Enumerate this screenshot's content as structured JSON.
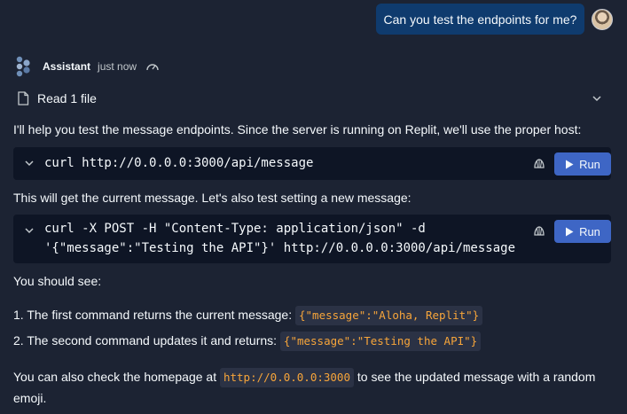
{
  "user_message": {
    "text": "Can you test the endpoints for me?"
  },
  "assistant": {
    "name": "Assistant",
    "time": "just now"
  },
  "read_file": {
    "label": "Read 1 file"
  },
  "intro": "I'll help you test the message endpoints. Since the server is running on Replit, we'll use the proper host:",
  "code_blocks": [
    {
      "lines": [
        "curl http://0.0.0.0:3000/api/message"
      ],
      "run_label": "Run"
    },
    {
      "lines": [
        "curl -X POST -H \"Content-Type: application/json\" -d",
        "'{\"message\":\"Testing the API\"}' http://0.0.0.0:3000/api/message"
      ],
      "run_label": "Run"
    }
  ],
  "mid_text": "This will get the current message. Let's also test setting a new message:",
  "should_see": "You should see:",
  "list": [
    {
      "prefix": "1. The first command returns the current message:",
      "code": "{\"message\":\"Aloha, Replit\"}"
    },
    {
      "prefix": "2. The second command updates it and returns:",
      "code": "{\"message\":\"Testing the API\"}"
    }
  ],
  "homepage": {
    "before": "You can also check the homepage at",
    "code": "http://0.0.0.0:3000",
    "after": "to see the updated message with a random",
    "line2": "emoji."
  },
  "colors": {
    "background": "#1c2333",
    "user_bubble": "#0f3b6e",
    "code_bg": "#0e1525",
    "run_button": "#3e66c5",
    "inline_code_text": "#f7a53a"
  },
  "icons": {
    "assistant_logo": "replit-agent-logo-icon",
    "speed": "speedometer-icon",
    "file": "file-icon",
    "chevron": "chevron-down-icon",
    "shell": "shell-icon",
    "run": "play-icon"
  }
}
